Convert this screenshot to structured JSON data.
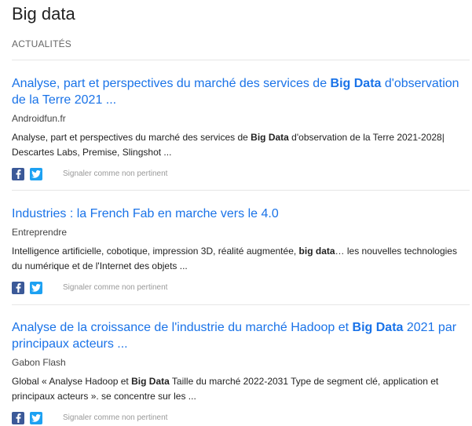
{
  "page": {
    "title": "Big data",
    "section_label": "ACTUALITÉS"
  },
  "colors": {
    "link": "#1a73e8",
    "facebook": "#3b5998",
    "twitter": "#1da1f2",
    "divider": "#e6e6e6"
  },
  "articles": [
    {
      "title_before": "Analyse, part et perspectives du marché des services de ",
      "title_highlight": "Big Data",
      "title_after": " d'observation de la Terre 2021 ...",
      "source": "Androidfun.fr",
      "snippet_before": "Analyse, part et perspectives du marché des services de ",
      "snippet_highlight": "Big Data",
      "snippet_after": " d'observation de la Terre 2021-2028| Descartes Labs, Premise, Slingshot ...",
      "share_icons": [
        "facebook-icon",
        "twitter-icon"
      ],
      "report_label": "Signaler comme non pertinent"
    },
    {
      "title_before": "Industries : la French Fab en marche vers le 4.0",
      "title_highlight": "",
      "title_after": "",
      "source": "Entreprendre",
      "snippet_before": "Intelligence artificielle, cobotique, impression 3D, réalité augmentée, ",
      "snippet_highlight": "big data",
      "snippet_after": "… les nouvelles technologies du numérique et de l'Internet des objets ...",
      "share_icons": [
        "facebook-icon",
        "twitter-icon"
      ],
      "report_label": "Signaler comme non pertinent"
    },
    {
      "title_before": "Analyse de la croissance de l'industrie du marché Hadoop et ",
      "title_highlight": "Big Data",
      "title_after": " 2021 par principaux acteurs ...",
      "source": "Gabon Flash",
      "snippet_before": "Global « Analyse Hadoop et ",
      "snippet_highlight": "Big Data",
      "snippet_after": " Taille du marché 2022-2031 Type de segment clé, application et principaux acteurs ». se concentre sur les ...",
      "share_icons": [
        "facebook-icon",
        "twitter-icon"
      ],
      "report_label": "Signaler comme non pertinent"
    }
  ]
}
